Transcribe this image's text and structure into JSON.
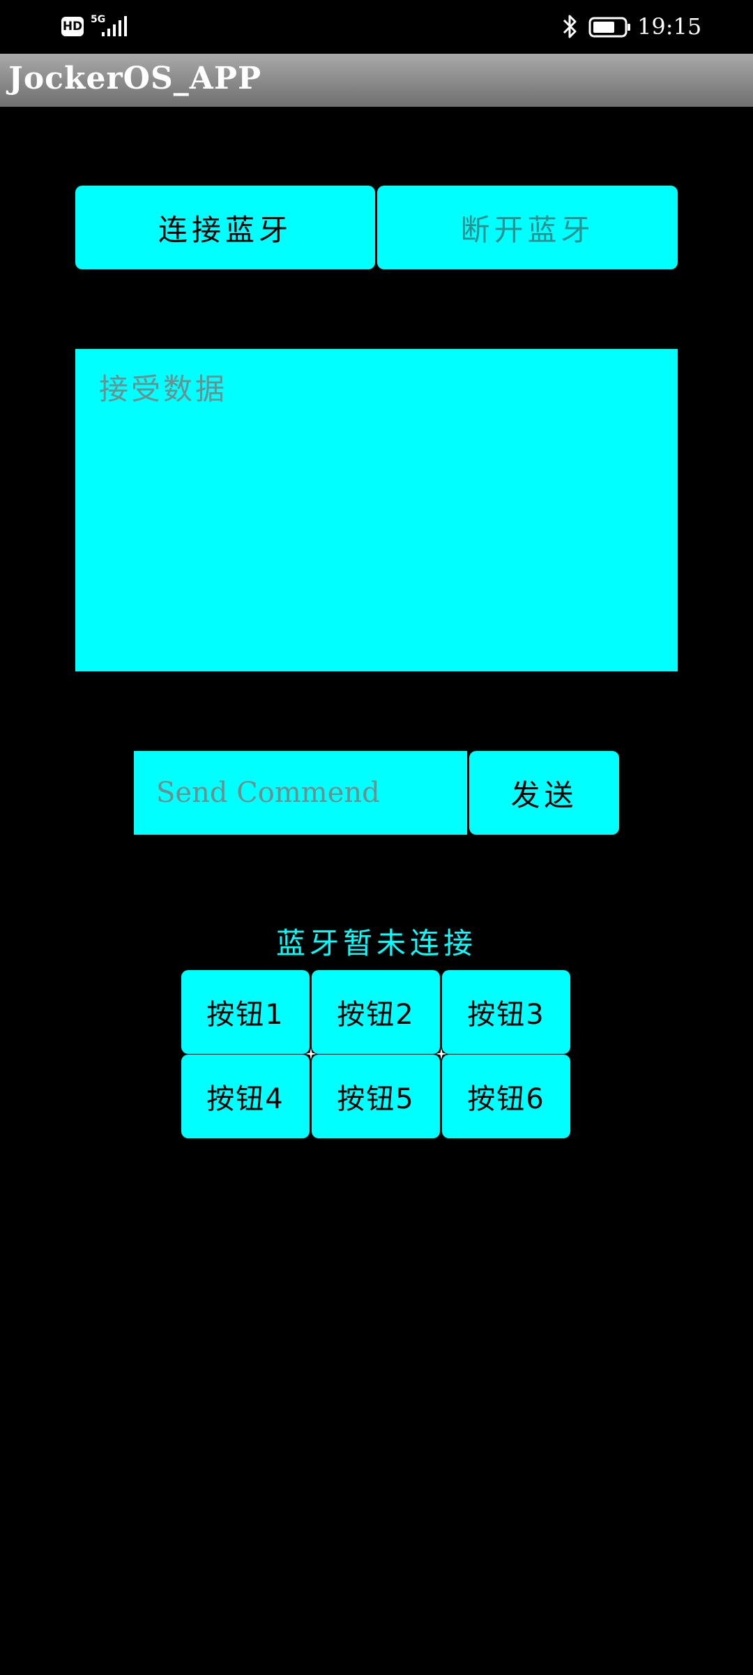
{
  "status_bar": {
    "hd_label": "HD",
    "network_label": "5G",
    "time": "19:15",
    "icons": [
      "signal-icon",
      "bluetooth-icon",
      "battery-icon"
    ]
  },
  "app": {
    "title": "JockerOS_APP"
  },
  "bluetooth_controls": {
    "connect_label": "连接蓝牙",
    "disconnect_label": "断开蓝牙"
  },
  "receive": {
    "placeholder": "接受数据"
  },
  "command": {
    "placeholder": "Send Commend",
    "value": "",
    "send_label": "发送"
  },
  "connection_status": "蓝牙暂未连接",
  "buttons": [
    {
      "label": "按钮1"
    },
    {
      "label": "按钮2"
    },
    {
      "label": "按钮3"
    },
    {
      "label": "按钮4"
    },
    {
      "label": "按钮5"
    },
    {
      "label": "按钮6"
    }
  ],
  "colors": {
    "accent": "#00ffff",
    "background": "#000000",
    "title_bar": "#8c8c8c"
  }
}
